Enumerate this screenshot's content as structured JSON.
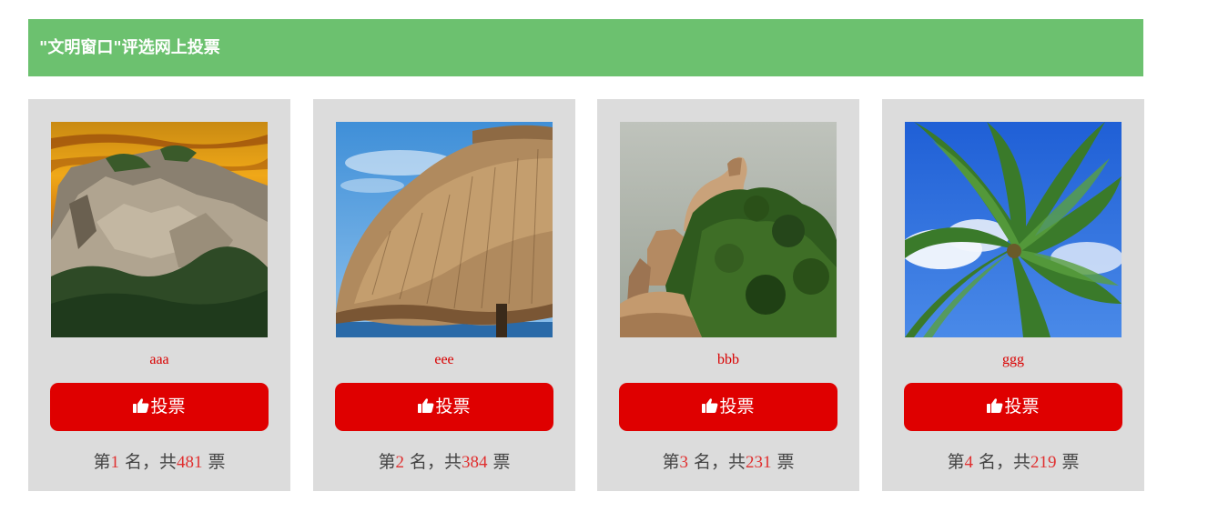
{
  "header": {
    "title": "\"文明窗口\"评选网上投票",
    "background": "#6cc16f"
  },
  "vote_button": {
    "label": "投票",
    "icon": "thumbs-up-icon",
    "color": "#df0000"
  },
  "cards": [
    {
      "name": "aaa",
      "rank_prefix": "第",
      "rank": "1",
      "rank_mid": " 名，共",
      "votes": "481",
      "rank_suffix": " 票",
      "image": "mountain-sunset-photo"
    },
    {
      "name": "eee",
      "rank_prefix": "第",
      "rank": "2",
      "rank_mid": " 名，共",
      "votes": "384",
      "rank_suffix": " 票",
      "image": "thatched-umbrella-photo"
    },
    {
      "name": "bbb",
      "rank_prefix": "第",
      "rank": "3",
      "rank_mid": " 名，共",
      "votes": "231",
      "rank_suffix": " 票",
      "image": "rock-peak-forest-photo"
    },
    {
      "name": "ggg",
      "rank_prefix": "第",
      "rank": "4",
      "rank_mid": " 名，共",
      "votes": "219",
      "rank_suffix": " 票",
      "image": "palm-tree-photo"
    }
  ]
}
